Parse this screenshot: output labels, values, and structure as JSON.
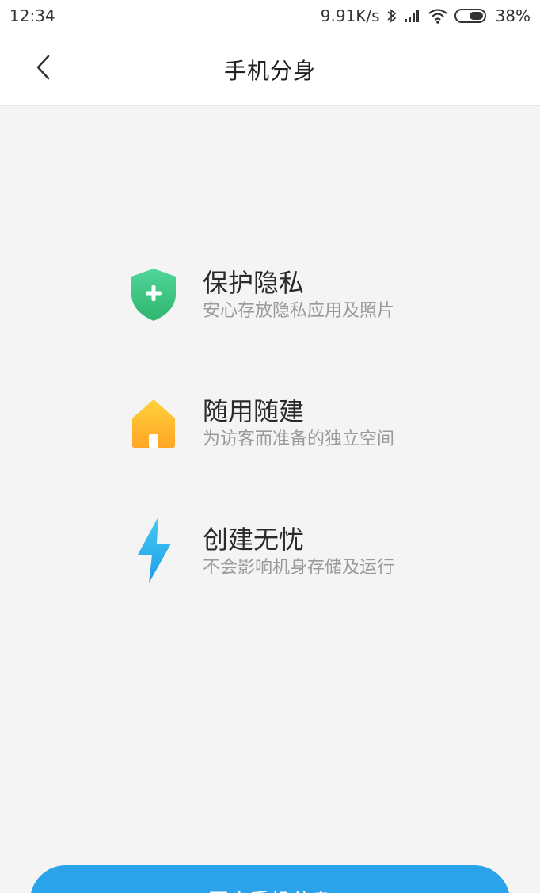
{
  "status_bar": {
    "time": "12:34",
    "net_speed": "9.91K/s",
    "battery": "38%",
    "icons": [
      "bluetooth-icon",
      "signal-icon",
      "wifi-icon",
      "battery-icon"
    ]
  },
  "header": {
    "title": "手机分身",
    "back_icon": "chevron-left-icon"
  },
  "features": [
    {
      "title": "保护隐私",
      "desc": "安心存放隐私应用及照片",
      "icon": "shield-plus-icon",
      "color": "#3fc77f"
    },
    {
      "title": "随用随建",
      "desc": "为访客而准备的独立空间",
      "icon": "house-icon",
      "color": "#ffb52a"
    },
    {
      "title": "创建无忧",
      "desc": "不会影响机身存储及运行",
      "icon": "lightning-icon",
      "color": "#2ab2ee"
    }
  ],
  "primary_button": {
    "label": "开启手机分身",
    "color": "#2aa3ea"
  }
}
